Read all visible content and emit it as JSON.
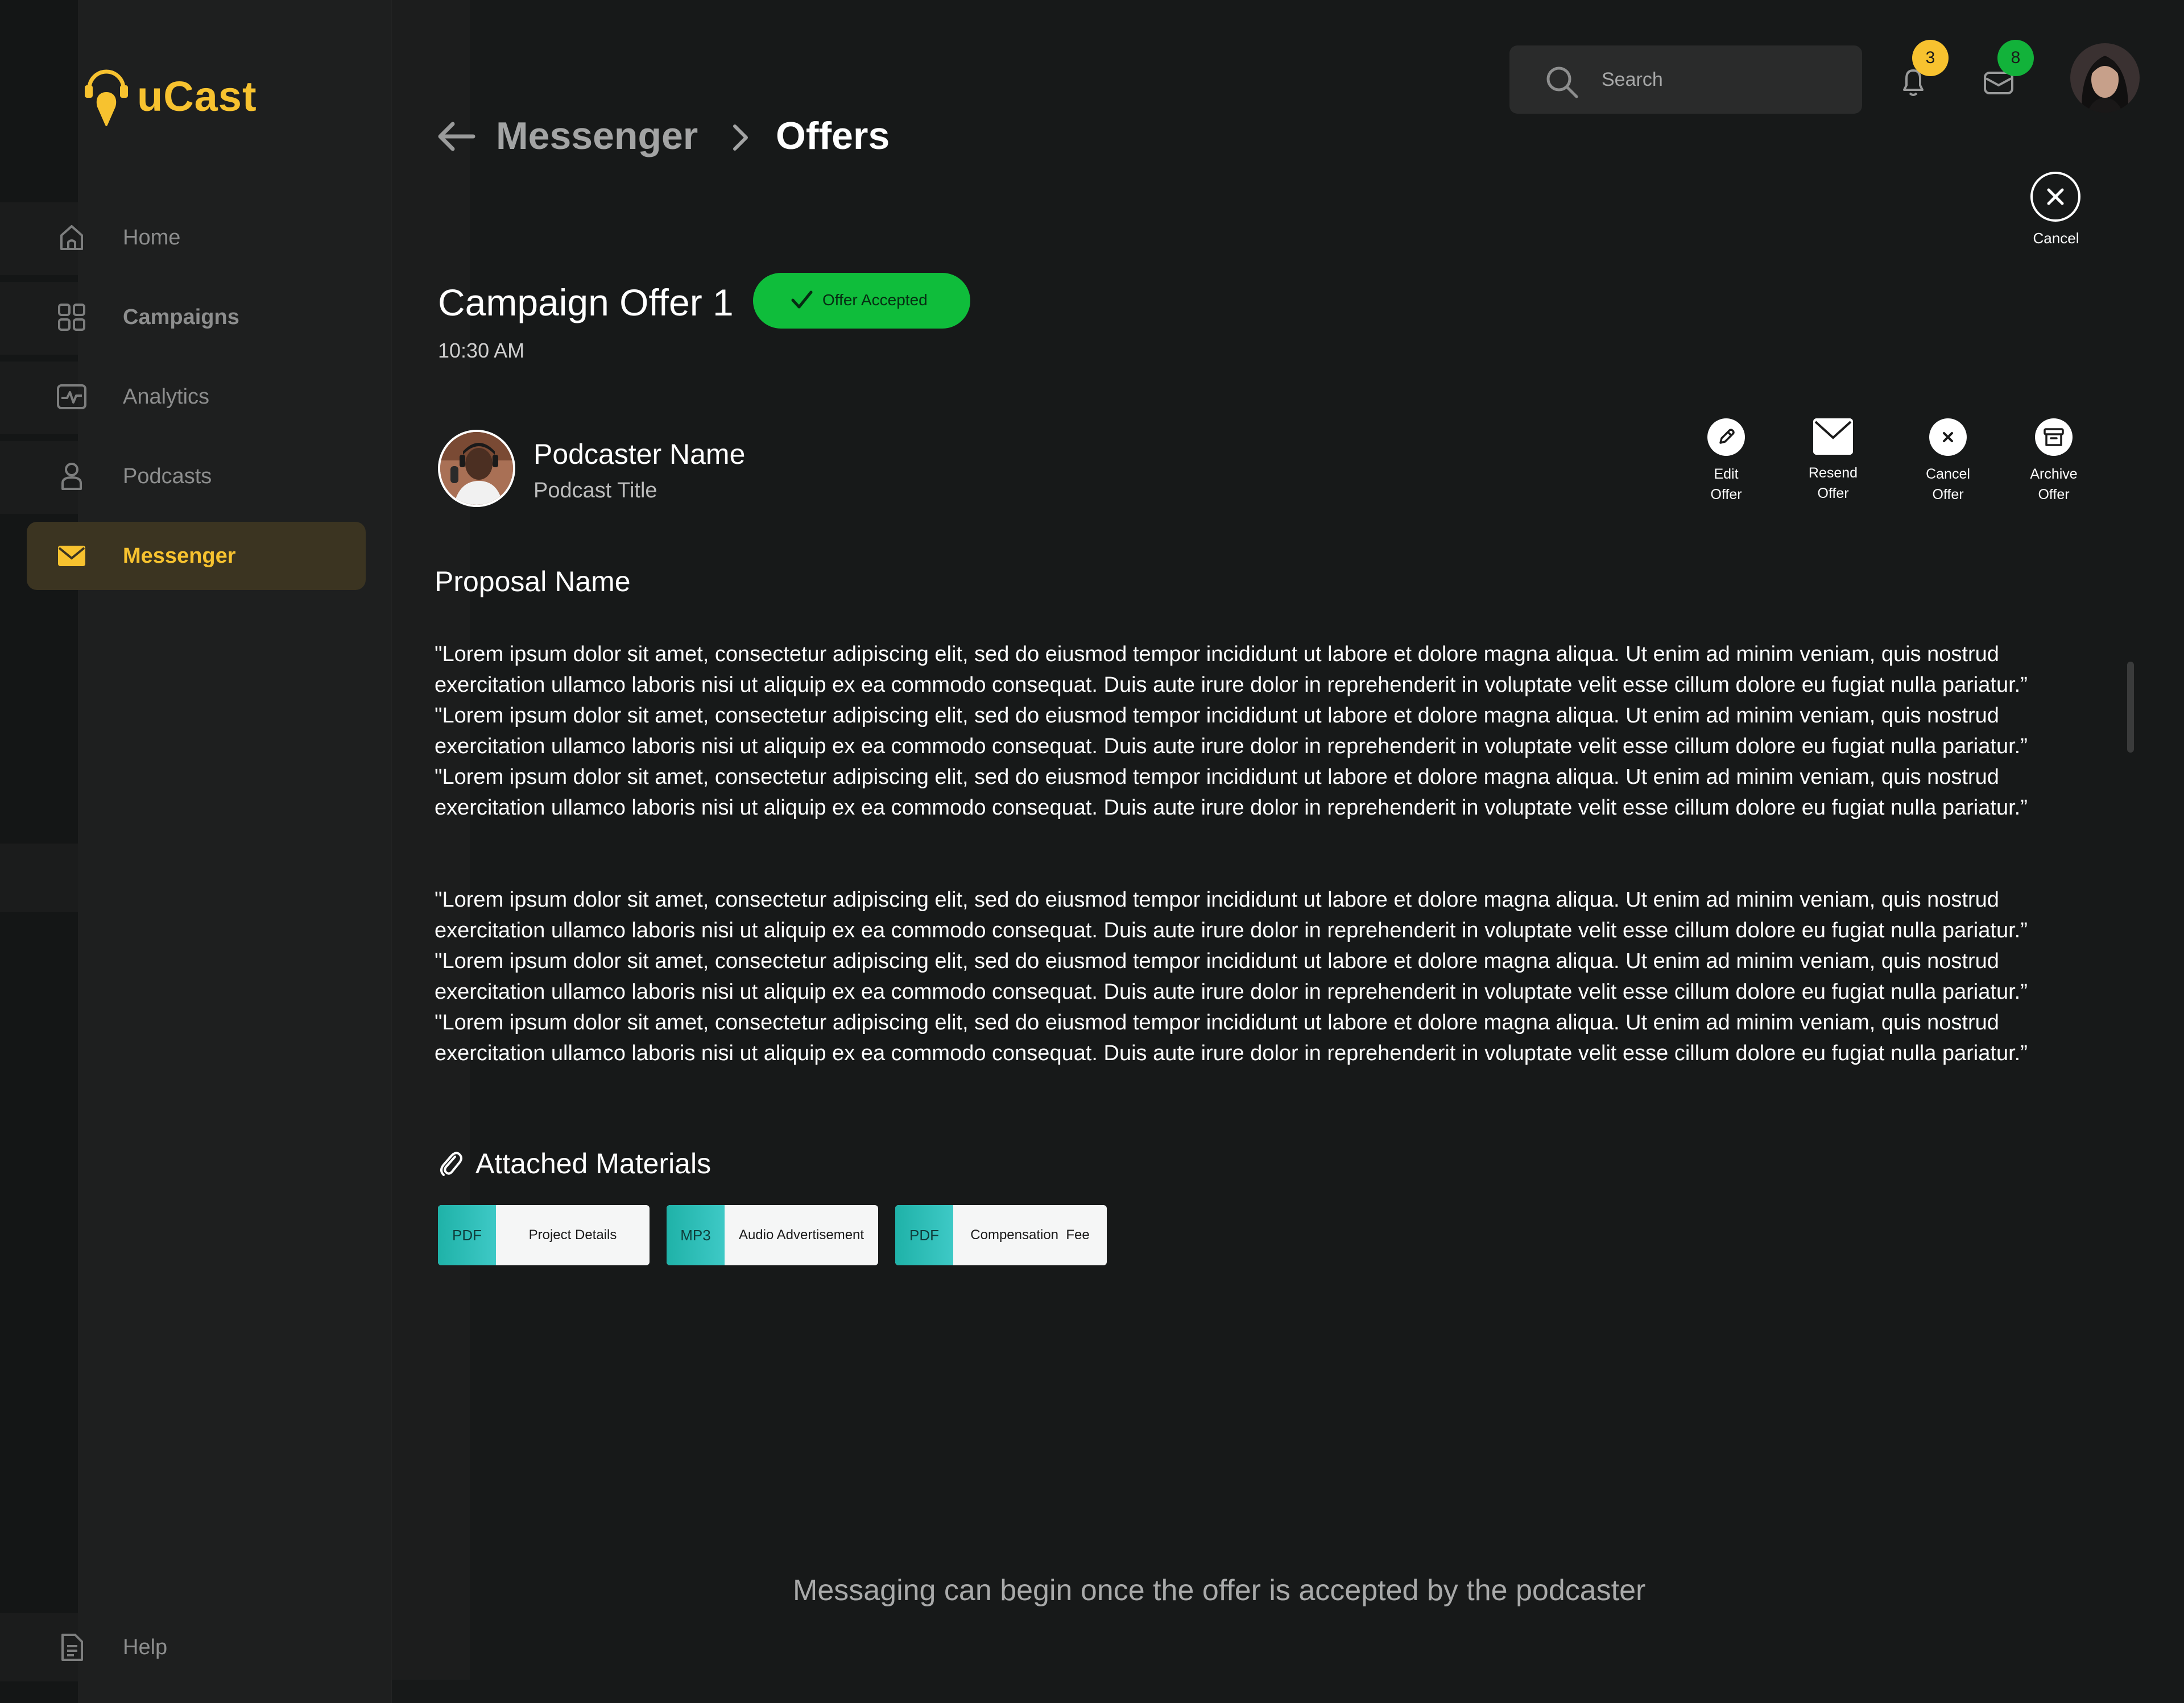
{
  "app": {
    "name": "uCast",
    "brand_color": "#f7c22f"
  },
  "sidebar": {
    "items": [
      {
        "label": "Home",
        "icon": "home-icon"
      },
      {
        "label": "Campaigns",
        "icon": "grid-icon"
      },
      {
        "label": "Analytics",
        "icon": "analytics-icon"
      },
      {
        "label": "Podcasts",
        "icon": "user-icon"
      },
      {
        "label": "Messenger",
        "icon": "mail-icon",
        "active": true
      }
    ],
    "help_label": "Help"
  },
  "header": {
    "breadcrumb": [
      "Messenger",
      "Offers"
    ],
    "search_placeholder": "Search",
    "notifications_count": "3",
    "messages_count": "8"
  },
  "offer": {
    "cancel_label": "Cancel",
    "title": "Campaign Offer 1",
    "status": "Offer Accepted",
    "status_color": "#0fbd3b",
    "time": "10:30 AM",
    "podcaster_name": "Podcaster Name",
    "podcast_title": "Podcast Title",
    "actions": [
      {
        "label_1": "Edit",
        "label_2": "Offer",
        "icon": "pencil-icon"
      },
      {
        "label_1": "Resend",
        "label_2": "Offer",
        "icon": "envelope-icon"
      },
      {
        "label_1": "Cancel",
        "label_2": "Offer",
        "icon": "close-icon"
      },
      {
        "label_1": "Archive",
        "label_2": "Offer",
        "icon": "archive-icon"
      }
    ],
    "proposal_name": "Proposal Name",
    "paragraphs": [
      "\"Lorem ipsum dolor sit amet, consectetur adipiscing elit, sed do eiusmod tempor incididunt ut labore et dolore magna aliqua. Ut enim ad minim veniam, quis nostrud exercitation ullamco laboris nisi ut aliquip ex ea commodo consequat. Duis aute irure dolor in reprehenderit in voluptate velit esse cillum dolore eu fugiat nulla pariatur.” \"Lorem ipsum dolor sit amet, consectetur adipiscing elit, sed do eiusmod tempor incididunt ut labore et dolore magna aliqua. Ut enim ad minim veniam, quis nostrud exercitation ullamco laboris nisi ut aliquip ex ea commodo consequat. Duis aute irure dolor in reprehenderit in voluptate velit esse cillum dolore eu fugiat nulla pariatur.” \"Lorem ipsum dolor sit amet, consectetur adipiscing elit, sed do eiusmod tempor incididunt ut labore et dolore magna aliqua. Ut enim ad minim veniam, quis nostrud exercitation ullamco laboris nisi ut aliquip ex ea commodo consequat. Duis aute irure dolor in reprehenderit in voluptate velit esse cillum dolore eu fugiat nulla pariatur.”",
      "\"Lorem ipsum dolor sit amet, consectetur adipiscing elit, sed do eiusmod tempor incididunt ut labore et dolore magna aliqua. Ut enim ad minim veniam, quis nostrud exercitation ullamco laboris nisi ut aliquip ex ea commodo consequat. Duis aute irure dolor in reprehenderit in voluptate velit esse cillum dolore eu fugiat nulla pariatur.” \"Lorem ipsum dolor sit amet, consectetur adipiscing elit, sed do eiusmod tempor incididunt ut labore et dolore magna aliqua. Ut enim ad minim veniam, quis nostrud exercitation ullamco laboris nisi ut aliquip ex ea commodo consequat. Duis aute irure dolor in reprehenderit in voluptate velit esse cillum dolore eu fugiat nulla pariatur.” \"Lorem ipsum dolor sit amet, consectetur adipiscing elit, sed do eiusmod tempor incididunt ut labore et dolore magna aliqua. Ut enim ad minim veniam, quis nostrud exercitation ullamco laboris nisi ut aliquip ex ea commodo consequat. Duis aute irure dolor in reprehenderit in voluptate velit esse cillum dolore eu fugiat nulla pariatur.”"
    ],
    "attached_label": "Attached Materials",
    "files": [
      {
        "type": "PDF",
        "name": "Project Details"
      },
      {
        "type": "MP3",
        "name": "Audio Advertisement"
      },
      {
        "type": "PDF",
        "name": "Compensation  Fee"
      }
    ]
  },
  "footer_message": "Messaging can begin once the offer is accepted by the podcaster"
}
